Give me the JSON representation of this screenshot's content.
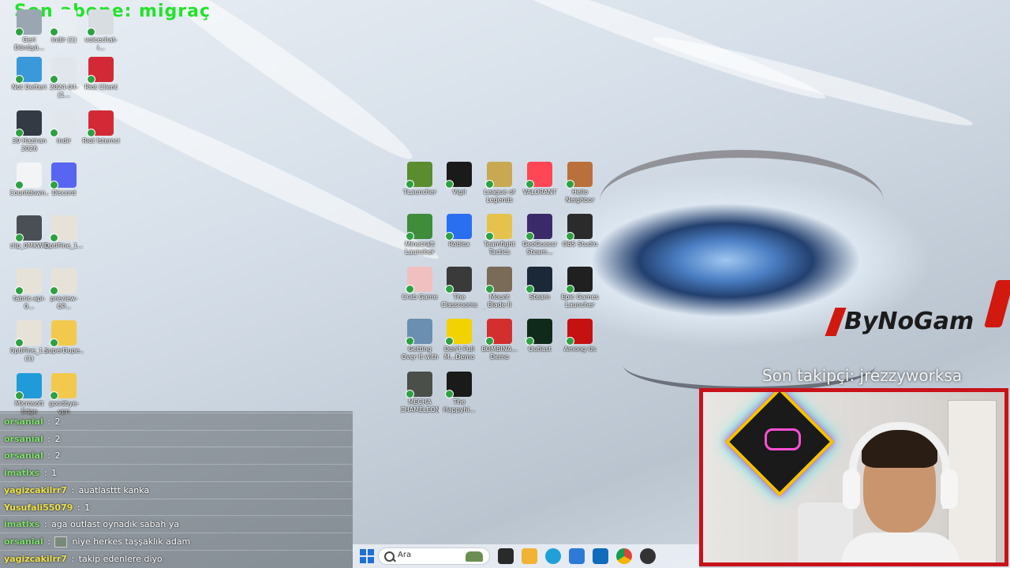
{
  "stream": {
    "last_subscriber": "Son abone: migraç",
    "last_follower": "Son takipçi: jrezzyworksa",
    "brand": "ByNoGam"
  },
  "desktop_icons": [
    {
      "label": "Geri Dönüşü...",
      "color": "#9aa6b2"
    },
    {
      "label": "indir (1)",
      "color": "#e9eef2"
    },
    {
      "label": "voicechat-i...",
      "color": "#d8dde2"
    },
    {
      "label": "Not Defteri",
      "color": "#3a9ad9"
    },
    {
      "label": "2024-04-(1...",
      "color": "#e0e6ec"
    },
    {
      "label": "Riot Client",
      "color": "#d32936"
    },
    {
      "label": "30 Haziran 2026",
      "color": "#333a44"
    },
    {
      "label": "indir",
      "color": "#e0e6ec"
    },
    {
      "label": "Riot İstemci",
      "color": "#d32936"
    },
    {
      "label": "Countdown...",
      "color": "#f2f4f6"
    },
    {
      "label": "Discord",
      "color": "#5865f2"
    },
    {
      "label": "clip_0MKW0...",
      "color": "#4a4f56"
    },
    {
      "label": "OptiFine_1...",
      "color": "#e7e2d8"
    },
    {
      "label": "fabric-api-0...",
      "color": "#e7e2d8"
    },
    {
      "label": "preview-OP...",
      "color": "#e7e2d8"
    },
    {
      "label": "OptiFine_1... (1)",
      "color": "#e7e2d8"
    },
    {
      "label": "SuperDupe...",
      "color": "#f2c94c"
    },
    {
      "label": "Microsoft Edge",
      "color": "#1f9bd9"
    },
    {
      "label": "goodbye-vpn",
      "color": "#f2c94c"
    },
    {
      "label": "TLauncher",
      "color": "#5b8c2e"
    },
    {
      "label": "Vigil",
      "color": "#1a1a1a"
    },
    {
      "label": "League of Legends",
      "color": "#c8a951"
    },
    {
      "label": "VALORANT",
      "color": "#ff4655"
    },
    {
      "label": "Hello Neighbor",
      "color": "#b9703a"
    },
    {
      "label": "Minecraft Launcher",
      "color": "#3f8c3a"
    },
    {
      "label": "Roblox",
      "color": "#2a6ff0"
    },
    {
      "label": "Teamfight Tactics",
      "color": "#e5c24b"
    },
    {
      "label": "GeoGuessr Steam...",
      "color": "#3a2a6a"
    },
    {
      "label": "OBS Studio",
      "color": "#2b2b2b"
    },
    {
      "label": "Crab Game",
      "color": "#f0c0c0"
    },
    {
      "label": "The Classrooms",
      "color": "#3a3a3a"
    },
    {
      "label": "Mount Blade II Bannerlord",
      "color": "#7a6a58"
    },
    {
      "label": "Steam",
      "color": "#1b2838"
    },
    {
      "label": "Epic Games Launcher",
      "color": "#202020"
    },
    {
      "label": "Getting Over It with Ben...",
      "color": "#6a8fb0"
    },
    {
      "label": "Don't Pull M...Demo",
      "color": "#f2d200"
    },
    {
      "label": "BOMBINA... Demo",
      "color": "#d32f2f"
    },
    {
      "label": "Outlast",
      "color": "#0f2a1a"
    },
    {
      "label": "Among Us",
      "color": "#c51111"
    },
    {
      "label": "MECHA CHAMELEON",
      "color": "#4a4f4a"
    },
    {
      "label": "The Happyhi...",
      "color": "#1a1a1a"
    }
  ],
  "chat": [
    {
      "user": "orsanial",
      "sep": ":",
      "msg": "2",
      "color": "#7fe06a"
    },
    {
      "user": "orsanial",
      "sep": ":",
      "msg": "2",
      "color": "#7fe06a"
    },
    {
      "user": "orsanial",
      "sep": ":",
      "msg": "2",
      "color": "#7fe06a"
    },
    {
      "user": "imatlxs",
      "sep": ":",
      "msg": "1",
      "color": "#7fe06a"
    },
    {
      "user": "yagizcakilrr7",
      "sep": ":",
      "msg": "auatlasttt kanka",
      "color": "#f0e44a"
    },
    {
      "user": "Yusufali55079",
      "sep": ":",
      "msg": "1",
      "color": "#f0e44a"
    },
    {
      "user": "imatlxs",
      "sep": ":",
      "msg": "aga outlast oynadık sabah ya",
      "color": "#7fe06a"
    },
    {
      "user": "orsanial",
      "sep": ":",
      "msg": "niye herkes taşşaklık adam",
      "color": "#7fe06a"
    },
    {
      "user": "yagizcakilrr7",
      "sep": ":",
      "msg": "takip edenlere diyo",
      "color": "#f0e44a"
    }
  ],
  "taskbar": {
    "search_placeholder": "Ara",
    "icons": [
      "start-icon",
      "task-view-icon",
      "file-explorer-icon",
      "edge-icon",
      "store-icon",
      "outlook-icon",
      "chrome-icon",
      "obs-icon"
    ]
  }
}
